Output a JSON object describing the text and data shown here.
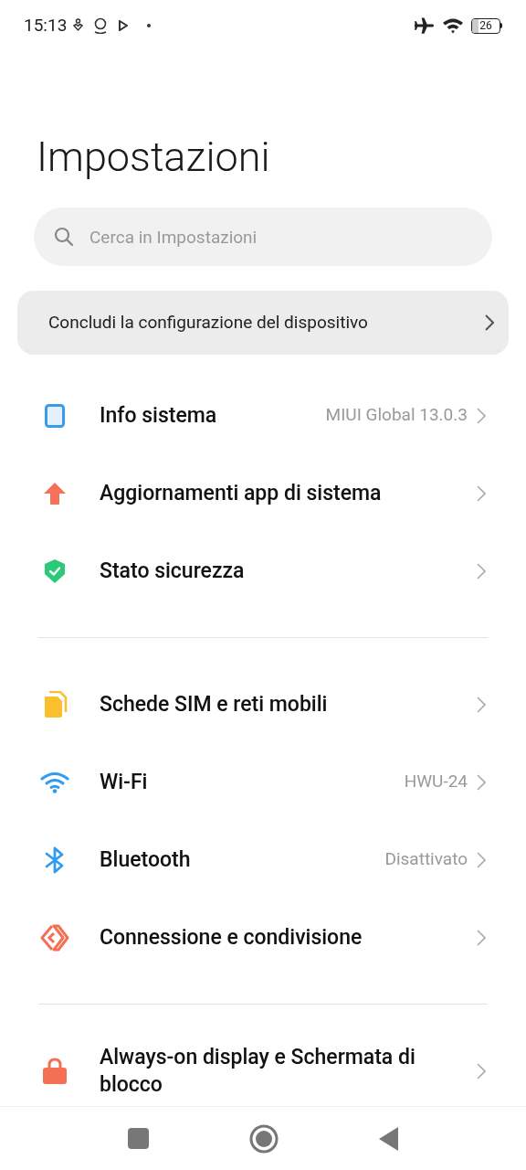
{
  "status_bar": {
    "time": "15:13",
    "battery": "26"
  },
  "title": "Impostazioni",
  "search": {
    "placeholder": "Cerca in Impostazioni"
  },
  "setup_banner": {
    "label": "Concludi la configurazione del dispositivo"
  },
  "groups": [
    {
      "items": [
        {
          "label": "Info sistema",
          "value": "MIUI Global 13.0.3"
        },
        {
          "label": "Aggiornamenti app di sistema"
        },
        {
          "label": "Stato sicurezza"
        }
      ]
    },
    {
      "items": [
        {
          "label": "Schede SIM e reti mobili"
        },
        {
          "label": "Wi-Fi",
          "value": "HWU-24"
        },
        {
          "label": "Bluetooth",
          "value": "Disattivato"
        },
        {
          "label": "Connessione e condivisione"
        }
      ]
    },
    {
      "items": [
        {
          "label": "Always-on display e Schermata di blocco"
        }
      ]
    }
  ]
}
